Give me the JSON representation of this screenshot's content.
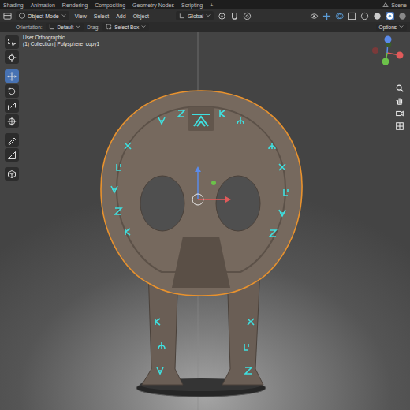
{
  "workspace_tabs": [
    {
      "label": "Shading",
      "selected": false
    },
    {
      "label": "Animation",
      "selected": false
    },
    {
      "label": "Rendering",
      "selected": false
    },
    {
      "label": "Compositing",
      "selected": false
    },
    {
      "label": "Geometry Nodes",
      "selected": false
    },
    {
      "label": "Scripting",
      "selected": false
    }
  ],
  "add_tab": "+",
  "scene": "Scene",
  "header": {
    "mode": "Object Mode",
    "menus": [
      "View",
      "Select",
      "Add",
      "Object"
    ],
    "orientation": "Global"
  },
  "tool_settings": {
    "orientation_label": "Orientation:",
    "orientation_value": "Default",
    "drag_label": "Drag:",
    "drag_value": "Select Box",
    "options": "Options"
  },
  "viewport": {
    "view_name": "User Orthographic",
    "object_info": "(1) Collection | Polysphere_copy1"
  },
  "toolbar": [
    {
      "selected": false
    },
    {
      "selected": false
    },
    {
      "selected": true
    },
    {
      "selected": false
    },
    {
      "selected": false
    },
    {
      "selected": false
    },
    {
      "selected": false
    },
    {
      "selected": false
    },
    {
      "selected": false
    }
  ],
  "object": {
    "selected": true
  }
}
